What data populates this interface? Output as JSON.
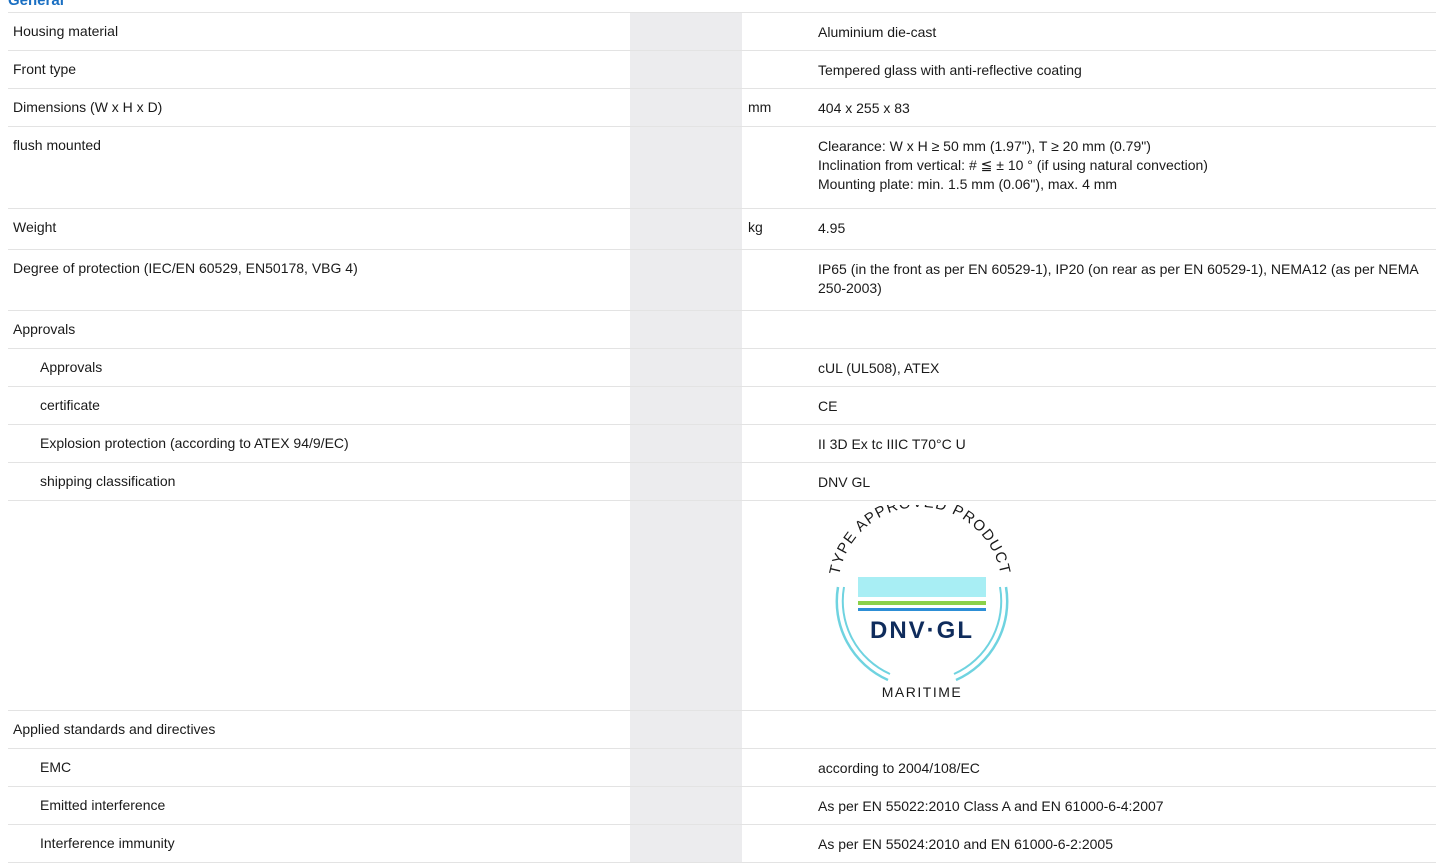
{
  "section": {
    "title": "General"
  },
  "rows": [
    {
      "label": "Housing material",
      "unit": "",
      "value": [
        "Aluminium die-cast"
      ]
    },
    {
      "label": "Front type",
      "unit": "",
      "value": [
        "Tempered glass with anti-reflective coating"
      ]
    },
    {
      "label": "Dimensions (W x H x D)",
      "unit": "mm",
      "value": [
        "404 x 255 x 83"
      ]
    },
    {
      "label": "flush mounted",
      "unit": "",
      "value": [
        "Clearance: W x H ≥ 50 mm (1.97\"), T ≥ 20 mm (0.79\")",
        "Inclination from vertical: # ≦ ± 10 ° (if using natural convection)",
        "Mounting plate: min. 1.5 mm (0.06\"), max. 4 mm"
      ]
    },
    {
      "label": "Weight",
      "unit": "kg",
      "value": [
        "4.95"
      ]
    },
    {
      "label": "Degree of protection (IEC/EN 60529, EN50178, VBG 4)",
      "unit": "",
      "value": [
        "IP65 (in the front as per EN 60529-1), IP20 (on rear as per EN 60529-1), NEMA12 (as per NEMA 250-2003)"
      ]
    },
    {
      "label": "Approvals",
      "unit": "",
      "value": [
        ""
      ]
    },
    {
      "label": "Approvals",
      "unit": "",
      "value": [
        "cUL (UL508), ATEX"
      ]
    },
    {
      "label": "certificate",
      "unit": "",
      "value": [
        "CE"
      ]
    },
    {
      "label": "Explosion protection (according to ATEX 94/9/EC)",
      "unit": "",
      "value": [
        "II 3D Ex tc IIIC T70°C U"
      ]
    },
    {
      "label": "shipping classification",
      "unit": "",
      "value": [
        "DNV GL"
      ]
    },
    {
      "label": "",
      "unit": "",
      "value": [
        ""
      ]
    },
    {
      "label": "Applied standards and directives",
      "unit": "",
      "value": [
        ""
      ]
    },
    {
      "label": "EMC",
      "unit": "",
      "value": [
        "according to 2004/108/EC"
      ]
    },
    {
      "label": "Emitted interference",
      "unit": "",
      "value": [
        "As per EN 55022:2010 Class A and EN 61000-6-4:2007"
      ]
    },
    {
      "label": "Interference immunity",
      "unit": "",
      "value": [
        "As per EN 55024:2010 and EN 61000-6-2:2005"
      ]
    }
  ],
  "logo": {
    "arc_text": "TYPE APPROVED PRODUCT",
    "brand": "DNV·GL",
    "bottom_text": "MARITIME",
    "colors": {
      "ring": "#6fd3e0",
      "band_top": "#a8eef4",
      "band_green": "#8bd14a",
      "band_blue": "#2d8fd6",
      "brand_text": "#0f2c5c"
    }
  }
}
